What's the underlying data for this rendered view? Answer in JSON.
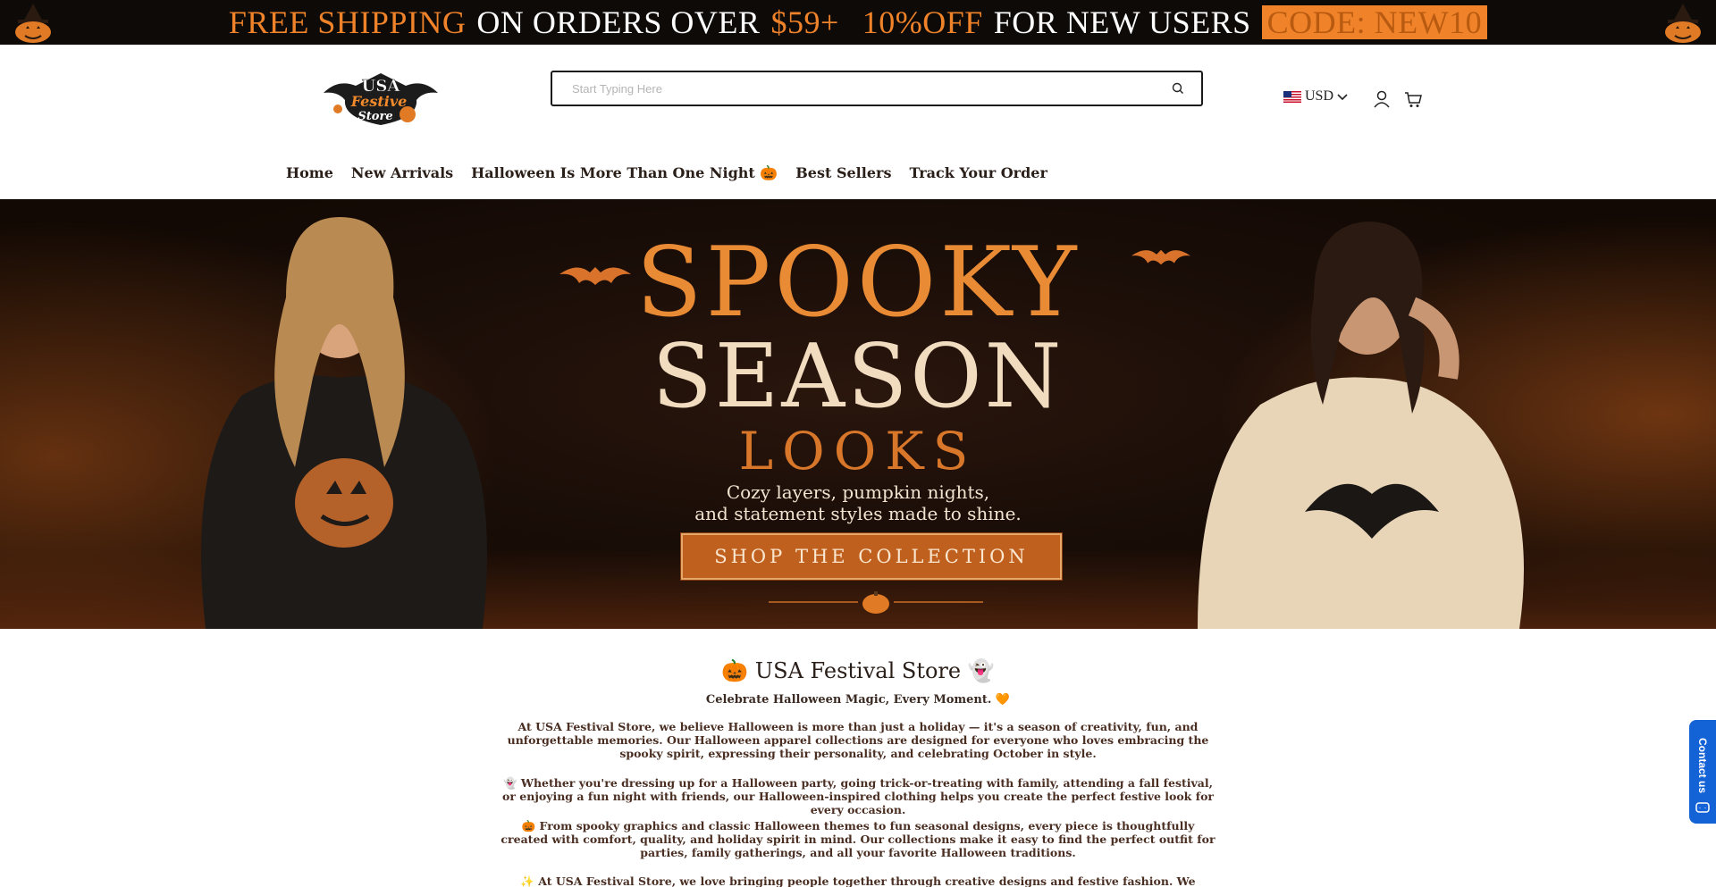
{
  "promo": {
    "part1": "FREE SHIPPING",
    "part2": "ON ORDERS OVER",
    "part3": "$59+",
    "part4": "10%OFF",
    "part5": "FOR NEW USERS",
    "code": "CODE: NEW10"
  },
  "header": {
    "logo_alt": "USA Festive Store",
    "search_placeholder": "Start Typing Here",
    "currency": "USD",
    "icons": [
      "search-icon",
      "account-icon",
      "cart-icon",
      "chevron-down-icon"
    ]
  },
  "nav": {
    "items": [
      "Home",
      "New Arrivals",
      "Halloween Is More Than One Night 🎃",
      "Best Sellers",
      "Track Your Order"
    ]
  },
  "hero": {
    "title1": "SPOOKY",
    "title2": "SEASON",
    "title3": "LOOKS",
    "sub1": "Cozy layers, pumpkin nights,",
    "sub2": "and statement styles made to shine.",
    "cta": "SHOP THE COLLECTION"
  },
  "content": {
    "title": "🎃 USA Festival Store 👻",
    "tagline": "Celebrate Halloween Magic, Every Moment. 🧡",
    "p1": "At USA Festival Store, we believe Halloween is more than just a holiday — it's a season of creativity, fun, and unforgettable memories. Our Halloween apparel collections are designed for everyone who loves embracing the spooky spirit, expressing their personality, and celebrating October in style.",
    "p2": "👻 Whether you're dressing up for a Halloween party, going trick-or-treating with family, attending a fall festival, or enjoying a fun night with friends, our Halloween-inspired clothing helps you create the perfect festive look for every occasion.",
    "p3": "🎃 From spooky graphics and classic Halloween themes to fun seasonal designs, every piece is thoughtfully created with comfort, quality, and holiday spirit in mind. Our collections make it easy to find the perfect outfit for parties, family gatherings, and all your favorite Halloween traditions.",
    "p4": "✨ At USA Festival Store, we love bringing people together through creative designs and festive fashion. We believe the best"
  },
  "contact": {
    "label": "Contact us"
  },
  "colors": {
    "promo_bg": "#0d0a08",
    "accent_orange": "#f0832a",
    "hero_cta": "#c0601f",
    "contact_blue": "#1463d6"
  }
}
